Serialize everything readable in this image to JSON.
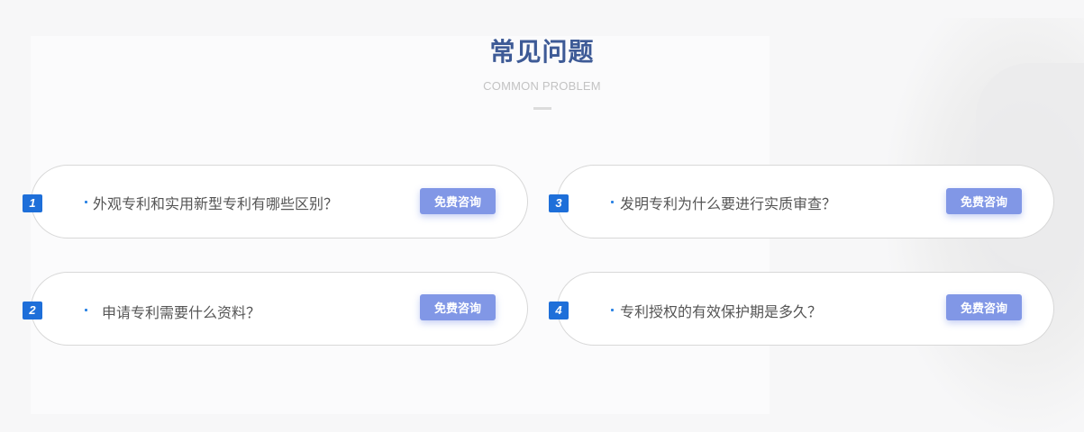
{
  "section": {
    "title": "常见问题",
    "subtitle": "COMMON PROBLEM"
  },
  "faq": [
    {
      "number": "1",
      "question": "外观专利和实用新型专利有哪些区别？",
      "button": "免费咨询"
    },
    {
      "number": "2",
      "question": "申请专利需要什么资料？",
      "button": "免费咨询"
    },
    {
      "number": "3",
      "question": "发明专利为什么要进行实质审查？",
      "button": "免费咨询"
    },
    {
      "number": "4",
      "question": "专利授权的有效保护期是多久？",
      "button": "免费咨询"
    }
  ],
  "colors": {
    "title": "#3d5a96",
    "accent": "#1e6fd9",
    "button": "#8197e6"
  }
}
